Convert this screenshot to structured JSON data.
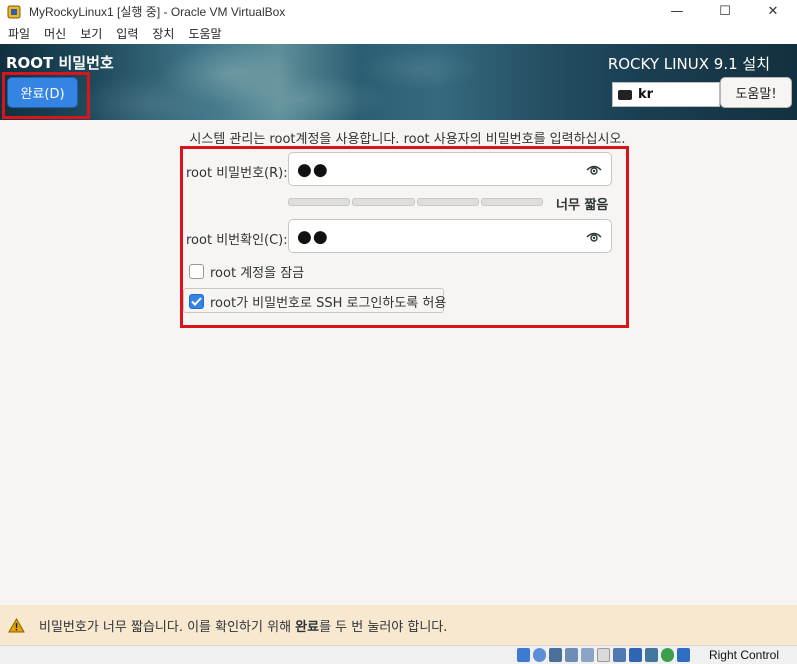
{
  "window": {
    "title": "MyRockyLinux1 [실행 중] - Oracle VM VirtualBox",
    "minimize": "—",
    "maximize": "☐",
    "close": "✕"
  },
  "menu": [
    "파일",
    "머신",
    "보기",
    "입력",
    "장치",
    "도움말"
  ],
  "header": {
    "title": "ROOT 비밀번호",
    "done_label": "완료(D)",
    "install_title": "ROCKY LINUX 9.1 설치",
    "keyboard_layout": "kr",
    "help_label": "도움말!"
  },
  "content": {
    "intro": "시스템 관리는 root계정을 사용합니다. root 사용자의 비밀번호를 입력하십시오.",
    "password_label": "root 비밀번호(R):",
    "password_value": "●●",
    "confirm_label": "root 비번확인(C):",
    "confirm_value": "●●",
    "strength_text": "너무 짧음",
    "strength_level": 0,
    "lock_root_label": "root 계정을 잠금",
    "lock_root_checked": false,
    "ssh_label": "root가 비밀번호로 SSH 로그인하도록 허용",
    "ssh_checked": true
  },
  "warning": {
    "text_before": "비밀번호가 너무 짧습니다. 이를 확인하기 위해 ",
    "text_bold": "완료",
    "text_after": "를 두 번 눌러야 합니다."
  },
  "statusbar": {
    "host_key": "Right Control"
  },
  "colors": {
    "accent": "#3584e4",
    "highlight_box": "#d9141a",
    "warning_bg": "#f8e8cf"
  }
}
